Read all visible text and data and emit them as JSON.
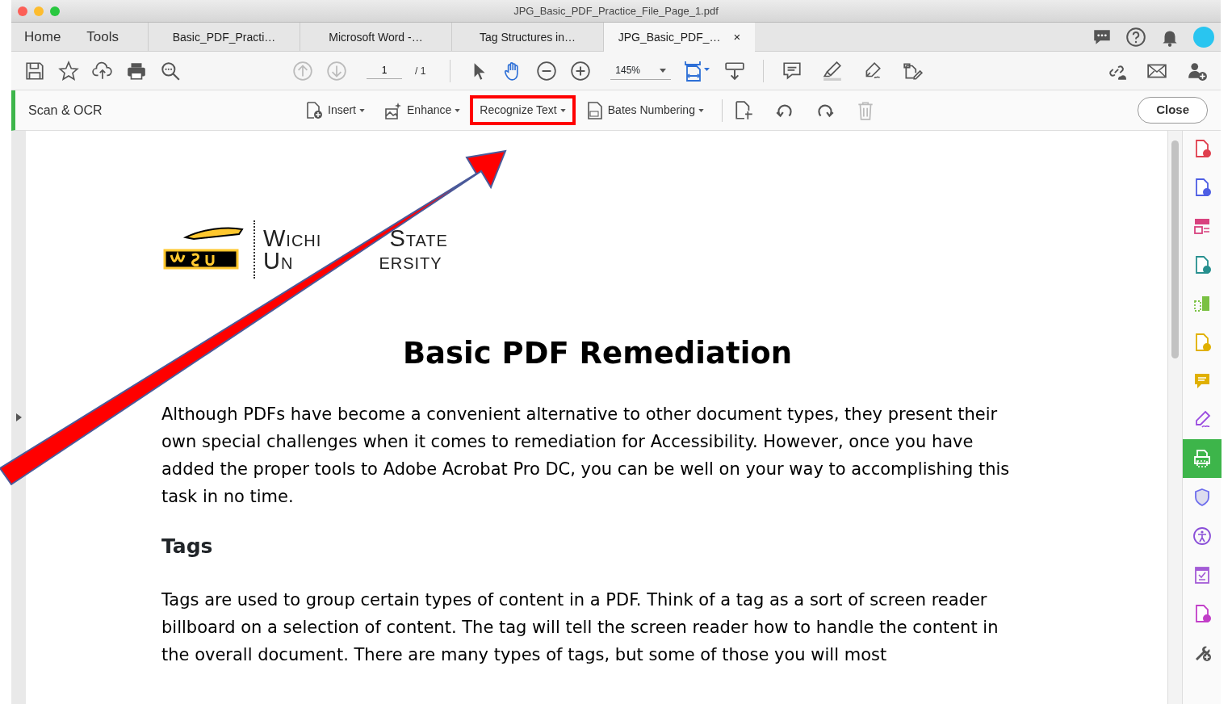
{
  "window": {
    "title": "JPG_Basic_PDF_Practice_File_Page_1.pdf"
  },
  "home_tabs": [
    {
      "label": "Home",
      "selected": false
    },
    {
      "label": "Tools",
      "selected": false
    }
  ],
  "tabs": [
    {
      "label": "Basic_PDF_Practi…",
      "selected": false
    },
    {
      "label": "Microsoft Word -…",
      "selected": false
    },
    {
      "label": "Tag Structures in…",
      "selected": false
    },
    {
      "label": "JPG_Basic_PDF_…",
      "selected": true
    }
  ],
  "tab_close": "×",
  "toolbar": {
    "page_current": "1",
    "page_total": "/ 1",
    "zoom": "145%"
  },
  "scan_toolbar": {
    "title": "Scan & OCR",
    "tools": [
      {
        "label": "Insert",
        "highlighted": false
      },
      {
        "label": "Enhance",
        "highlighted": false
      },
      {
        "label": "Recognize Text",
        "highlighted": true
      },
      {
        "label": "Bates Numbering",
        "highlighted": false
      }
    ],
    "close": "Close"
  },
  "document": {
    "logo_lines": [
      [
        "Wichi",
        "State"
      ],
      [
        "Un",
        "ersity"
      ]
    ],
    "heading": "Basic PDF Remediation",
    "paragraph_1": "Although PDFs have become a convenient alternative to other document types, they present their own special challenges when it comes to remediation for Accessibility. However, once you have added the proper tools to Adobe Acrobat Pro DC, you can be well on your way to accomplishing this task in no time.",
    "subheading": "Tags",
    "paragraph_2": "Tags are used to group certain types of content in a PDF. Think of a tag as a sort of screen reader billboard on a selection of content. The tag will tell the screen reader how to handle the content in the overall document. There are many types of tags, but some of those you will most"
  },
  "right_rail": [
    {
      "kind": "doc",
      "color": "#e0404f",
      "selected": false
    },
    {
      "kind": "doc",
      "color": "#4e5ee4",
      "selected": false
    },
    {
      "kind": "form",
      "color": "#d8427f",
      "selected": false
    },
    {
      "kind": "doc",
      "color": "#27908f",
      "selected": false
    },
    {
      "kind": "pages",
      "color": "#7ac143",
      "selected": false
    },
    {
      "kind": "doc",
      "color": "#e0b000",
      "selected": false
    },
    {
      "kind": "speech",
      "color": "#e0b000",
      "selected": false
    },
    {
      "kind": "pen",
      "color": "#9b4de0",
      "selected": false
    },
    {
      "kind": "print",
      "color": "#3db54a",
      "selected": true
    },
    {
      "kind": "shield",
      "color": "#6d6ded",
      "selected": false
    },
    {
      "kind": "person",
      "color": "#8a4fd8",
      "selected": false
    },
    {
      "kind": "check",
      "color": "#a35bd6",
      "selected": false
    },
    {
      "kind": "doc",
      "color": "#c23fc8",
      "selected": false
    },
    {
      "kind": "wrench",
      "color": "#555555",
      "selected": false
    }
  ]
}
